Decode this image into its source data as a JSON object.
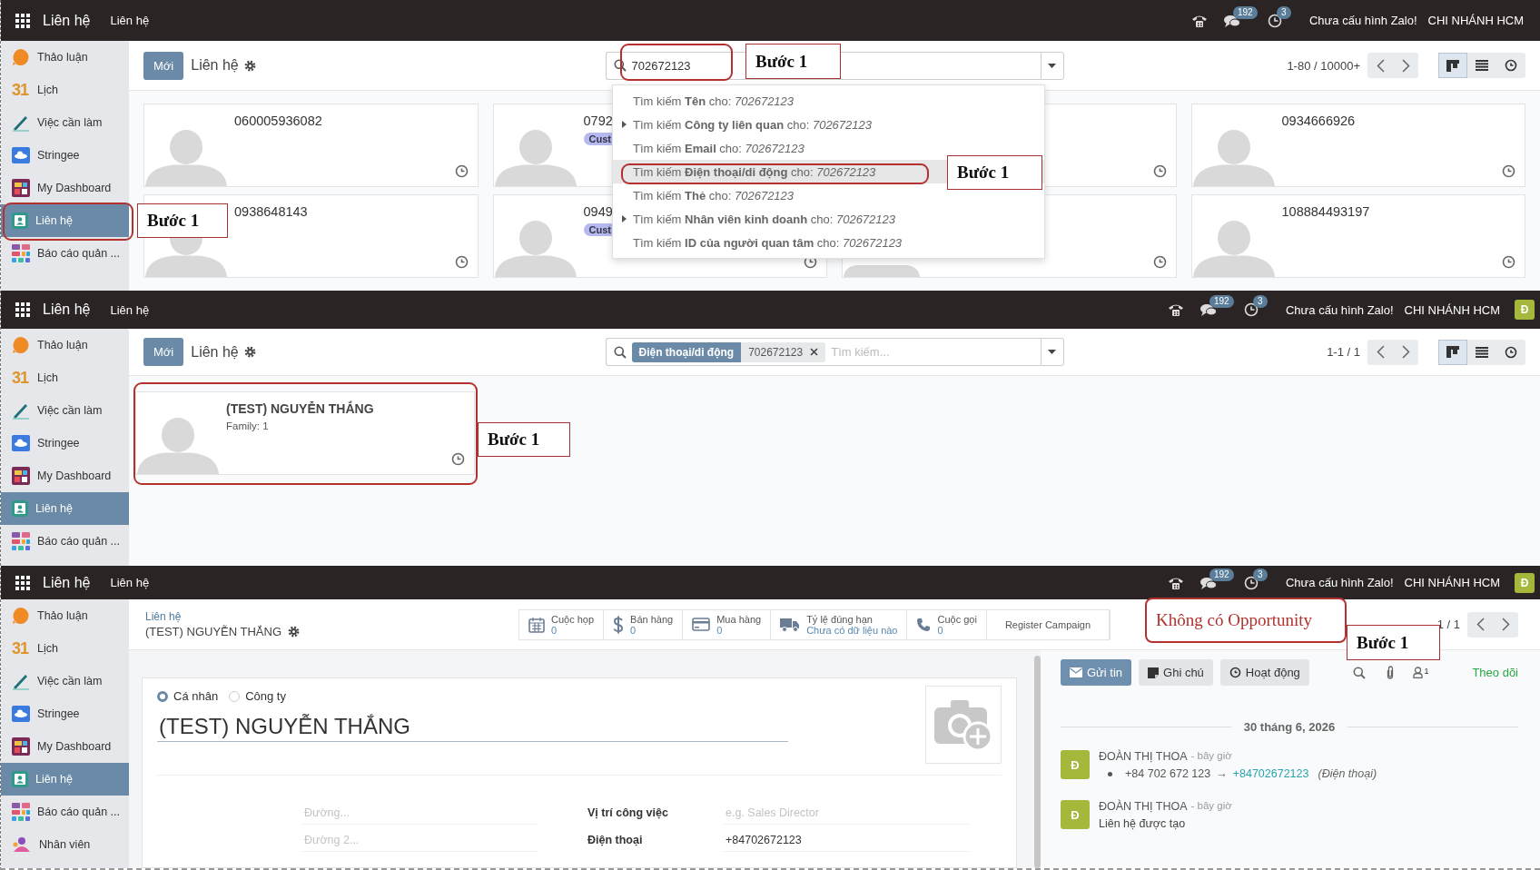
{
  "panels": [
    {
      "kind": "kanban_search",
      "topbar": {
        "app": "Liên hệ",
        "menu": "Liên hệ",
        "chat_count": "192",
        "activity_count": "3",
        "zalo": "Chưa cấu hình Zalo!",
        "company": "CHI NHÁNH HCM"
      },
      "sidebar": [
        {
          "kind": "discuss",
          "label": "Thảo luận",
          "selected": false
        },
        {
          "kind": "calendar",
          "icon_text": "31",
          "label": "Lịch",
          "selected": false
        },
        {
          "kind": "todo",
          "label": "Việc cần làm",
          "selected": false
        },
        {
          "kind": "stringee",
          "label": "Stringee",
          "selected": false
        },
        {
          "kind": "dashboard",
          "label": "My Dashboard",
          "selected": false
        },
        {
          "kind": "contacts",
          "label": "Liên hệ",
          "selected": true
        },
        {
          "kind": "reports",
          "label": "Báo cáo quản ...",
          "selected": false
        }
      ],
      "control": {
        "new_button": "Mới",
        "title": "Liên hệ",
        "search": {
          "value": "702672123"
        },
        "pager": "1-80 / 10000+",
        "views": [
          {
            "kind": "kanban",
            "selected": true
          },
          {
            "kind": "list",
            "selected": false
          },
          {
            "kind": "activity",
            "selected": false
          }
        ]
      },
      "cards": [
        {
          "kind": "contact",
          "title": "060005936082"
        },
        {
          "kind": "covered_right",
          "title": "0792",
          "tag": "Cust"
        },
        {
          "kind": "covered_full"
        },
        {
          "kind": "contact",
          "title": "0934666926"
        },
        {
          "kind": "contact",
          "title": "0938648143"
        },
        {
          "kind": "contact",
          "title": "0949",
          "tag": "Cust"
        },
        {
          "kind": "covered_top"
        },
        {
          "kind": "contact",
          "title": "108884493197"
        }
      ],
      "search_menu": [
        {
          "text": "Tìm kiếm **Tên** cho: *702672123*",
          "expandable": false,
          "selected": false
        },
        {
          "text": "Tìm kiếm **Công ty liên quan** cho: *702672123*",
          "expandable": true,
          "selected": false
        },
        {
          "text": "Tìm kiếm **Email** cho: *702672123*",
          "expandable": false,
          "selected": false
        },
        {
          "text": "Tìm kiếm **Điện thoại/di động** cho: *702672123*",
          "expandable": false,
          "selected": true
        },
        {
          "text": "Tìm kiếm **Thẻ** cho: *702672123*",
          "expandable": false,
          "selected": false
        },
        {
          "text": "Tìm kiếm **Nhân viên kinh doanh** cho: *702672123*",
          "expandable": true,
          "selected": false
        },
        {
          "text": "Tìm kiếm **ID của người quan tâm** cho: *702672123*",
          "expandable": false,
          "selected": false
        }
      ],
      "annotations": [
        {
          "kind": "ring"
        },
        {
          "kind": "callout",
          "text": "Bước 1"
        },
        {
          "kind": "ring"
        },
        {
          "kind": "callout",
          "text": "Bước 1"
        },
        {
          "kind": "ring"
        },
        {
          "kind": "callout",
          "text": "Bước 1"
        }
      ]
    },
    {
      "kind": "kanban_filtered",
      "topbar": {
        "app": "Liên hệ",
        "menu": "Liên hệ",
        "chat_count": "192",
        "activity_count": "3",
        "zalo": "Chưa cấu hình Zalo!",
        "company": "CHI NHÁNH HCM",
        "avatar": "Đ"
      },
      "sidebar": [
        {
          "kind": "discuss",
          "label": "Thảo luận",
          "selected": false
        },
        {
          "kind": "calendar",
          "icon_text": "31",
          "label": "Lịch",
          "selected": false
        },
        {
          "kind": "todo",
          "label": "Việc cần làm",
          "selected": false
        },
        {
          "kind": "stringee",
          "label": "Stringee",
          "selected": false
        },
        {
          "kind": "dashboard",
          "label": "My Dashboard",
          "selected": false
        },
        {
          "kind": "contacts",
          "label": "Liên hệ",
          "selected": true
        },
        {
          "kind": "reports",
          "label": "Báo cáo quản ...",
          "selected": false
        }
      ],
      "control": {
        "new_button": "Mới",
        "title": "Liên hệ",
        "search": {
          "facet": {
            "label": "Điện thoại/di động",
            "value": "702672123"
          },
          "placeholder": "Tìm kiếm..."
        },
        "pager": "1-1 / 1",
        "views": [
          {
            "kind": "kanban",
            "selected": true
          },
          {
            "kind": "list",
            "selected": false
          },
          {
            "kind": "activity",
            "selected": false
          }
        ]
      },
      "cards": [
        {
          "kind": "contact",
          "title": "(TEST) NGUYỄN THẮNG",
          "subtitle": "Family: 1"
        }
      ],
      "annotations": [
        {
          "kind": "ring"
        },
        {
          "kind": "callout",
          "text": "Bước 1"
        }
      ]
    },
    {
      "kind": "form",
      "topbar": {
        "app": "Liên hệ",
        "menu": "Liên hệ",
        "chat_count": "192",
        "activity_count": "3",
        "zalo": "Chưa cấu hình Zalo!",
        "company": "CHI NHÁNH HCM",
        "avatar": "Đ"
      },
      "sidebar": [
        {
          "kind": "discuss",
          "label": "Thảo luận",
          "selected": false
        },
        {
          "kind": "calendar",
          "icon_text": "31",
          "label": "Lịch",
          "selected": false
        },
        {
          "kind": "todo",
          "label": "Việc cần làm",
          "selected": false
        },
        {
          "kind": "stringee",
          "label": "Stringee",
          "selected": false
        },
        {
          "kind": "dashboard",
          "label": "My Dashboard",
          "selected": false
        },
        {
          "kind": "contacts",
          "label": "Liên hệ",
          "selected": true
        },
        {
          "kind": "reports",
          "label": "Báo cáo quản ...",
          "selected": false
        },
        {
          "kind": "employees",
          "label": "Nhân viên",
          "selected": false
        }
      ],
      "breadcrumb": "Liên hệ",
      "title": "(TEST) NGUYỄN THẮNG",
      "smart_buttons": [
        {
          "kind": "calendar",
          "label": "Cuộc họp",
          "value": "0"
        },
        {
          "kind": "dollar",
          "label": "Bán hàng",
          "value": "0"
        },
        {
          "kind": "card",
          "label": "Mua hàng",
          "value": "0"
        },
        {
          "kind": "truck",
          "label": "Tỷ lệ đúng hạn",
          "value": "Chưa có dữ liệu nào"
        },
        {
          "kind": "phone",
          "label": "Cuộc gọi",
          "value": "0"
        },
        {
          "kind": "text",
          "label": "Register Campaign"
        }
      ],
      "pager": "1 / 1",
      "form": {
        "radios": [
          {
            "label": "Cá nhân",
            "selected": true
          },
          {
            "label": "Công ty",
            "selected": false
          }
        ],
        "name": "(TEST) NGUYỄN THẮNG",
        "address": [
          {
            "placeholder": "Đường..."
          },
          {
            "placeholder": "Đường 2..."
          }
        ],
        "fields": [
          {
            "label": "Vị trí công việc",
            "placeholder": "e.g. Sales Director"
          },
          {
            "label": "Điện thoại",
            "value": "+84702672123"
          }
        ]
      },
      "chatter": {
        "buttons": [
          {
            "kind": "send",
            "label": "Gửi tin",
            "active": true
          },
          {
            "kind": "note",
            "label": "Ghi chú",
            "active": false
          },
          {
            "kind": "activity",
            "label": "Hoạt động",
            "active": false
          }
        ],
        "follower_count": "1",
        "follow": "Theo dõi",
        "date": "30 tháng 6, 2026",
        "messages": [
          {
            "kind": "tracking",
            "avatar": "Đ",
            "author": "ĐOÀN THỊ THOA",
            "time": "- bây giờ",
            "old": "+84 702 672 123",
            "arrow": "→",
            "new": "+84702672123",
            "field": "(Điện thoại)"
          },
          {
            "kind": "text",
            "avatar": "Đ",
            "author": "ĐOÀN THỊ THOA",
            "time": "- bây giờ",
            "body": "Liên hệ được tạo"
          }
        ]
      },
      "annotations": [
        {
          "kind": "label",
          "text": "Không có Opportunity"
        },
        {
          "kind": "callout",
          "text": "Bước 1"
        }
      ]
    }
  ]
}
